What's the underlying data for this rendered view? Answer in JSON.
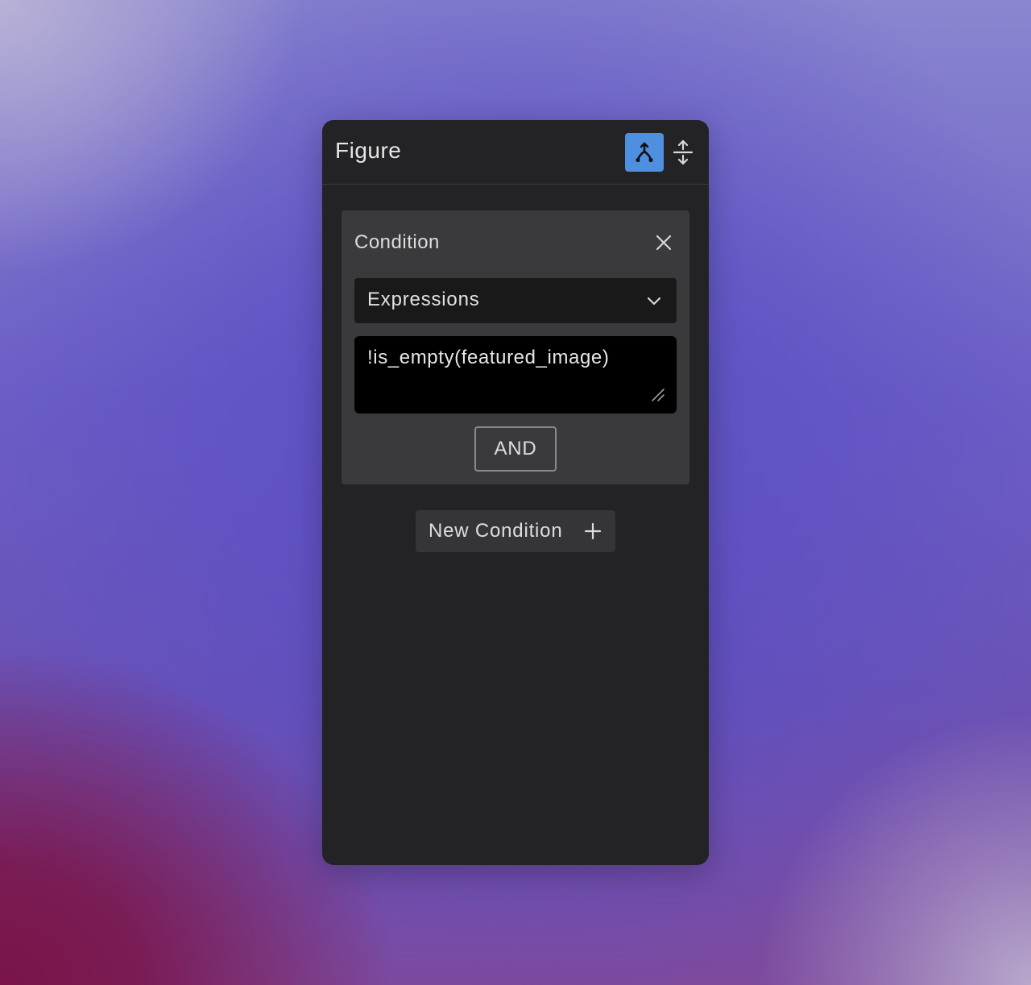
{
  "panel": {
    "title": "Figure",
    "header_icons": {
      "active": "branch-merge-icon",
      "secondary": "vertical-expand-icon"
    }
  },
  "condition": {
    "title": "Condition",
    "close_icon": "close-icon",
    "select": {
      "value": "Expressions",
      "chevron_icon": "chevron-down-icon"
    },
    "expression": {
      "value": "!is_empty(featured_image)"
    },
    "and_label": "AND"
  },
  "new_condition": {
    "label": "New Condition",
    "icon": "plus-icon"
  },
  "colors": {
    "accent": "#4f8fe0",
    "panel_bg": "#232325",
    "card_bg": "#3a3a3d"
  }
}
